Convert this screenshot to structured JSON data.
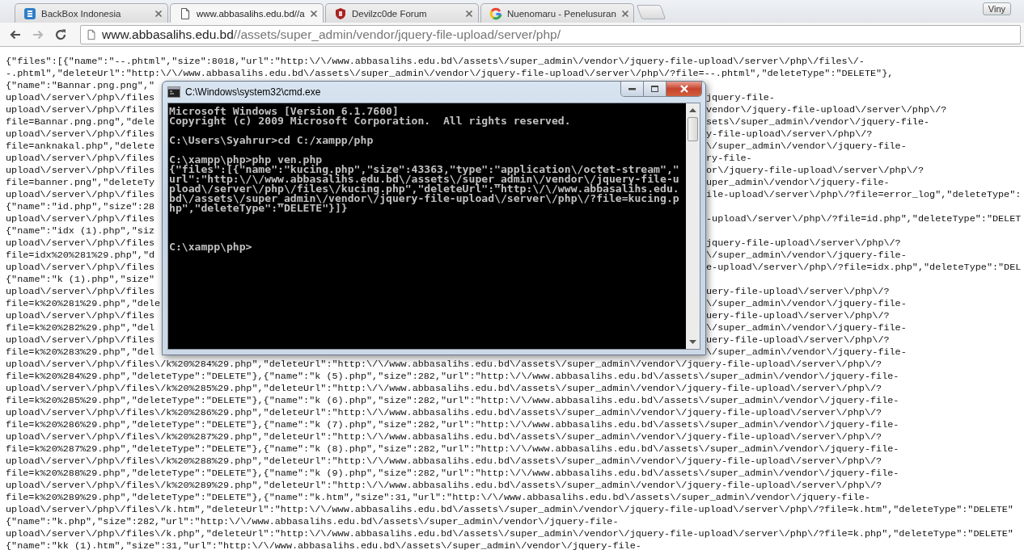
{
  "browser": {
    "tabs": [
      {
        "title": "BackBox Indonesia",
        "kind": "badge",
        "selected": false
      },
      {
        "title": "www.abbasalihs.edu.bd//a",
        "kind": "page",
        "selected": true
      },
      {
        "title": "Devilzc0de Forum",
        "kind": "shield",
        "selected": false
      },
      {
        "title": "Nuenomaru - Penelusuran",
        "kind": "ring",
        "selected": false
      }
    ],
    "profile": "Viny",
    "nav": [
      {
        "kind": "back",
        "disabled": false
      },
      {
        "kind": "forward",
        "disabled": true
      },
      {
        "kind": "reload",
        "disabled": false
      }
    ],
    "address": {
      "host": "www.abbasalihs.edu.bd",
      "path": "//assets/super_admin/vendor/jquery-file-upload/server/php/"
    }
  },
  "page_lines": [
    {
      "kind": "full",
      "text": "{\"files\":[{\"name\":\"--.phtml\",\"size\":8018,\"url\":\"http:\\/\\/www.abbasalihs.edu.bd\\/assets\\/super_admin\\/vendor\\/jquery-file-upload\\/server\\/php\\/files\\/-"
    },
    {
      "kind": "full",
      "text": "-.phtml\",\"deleteUrl\":\"http:\\/\\/www.abbasalihs.edu.bd\\/assets\\/super_admin\\/vendor\\/jquery-file-upload\\/server\\/php\\/?file=--.phtml\",\"deleteType\":\"DELETE\"},"
    },
    {
      "kind": "split",
      "left": "{\"name\":\"Bannar.png.png\",\""
    },
    {
      "kind": "split",
      "left": "upload\\/server\\/php\\/files",
      "right": "jquery-file-"
    },
    {
      "kind": "split",
      "left": "upload\\/server\\/php\\/files",
      "right": "vendor\\/jquery-file-upload\\/server\\/php\\/?"
    },
    {
      "kind": "split",
      "left": "file=Bannar.png.png\",\"dele",
      "right": "sets\\/super_admin\\/vendor\\/jquery-file-"
    },
    {
      "kind": "split",
      "left": "upload\\/server\\/php\\/files",
      "right": "y-file-upload\\/server\\/php\\/?"
    },
    {
      "kind": "split",
      "left": "file=anknakal.php\",\"delete",
      "right": "\\/super_admin\\/vendor\\/jquery-file-"
    },
    {
      "kind": "split",
      "left": "upload\\/server\\/php\\/files",
      "right": "ry-file-"
    },
    {
      "kind": "split",
      "left": "upload\\/server\\/php\\/files",
      "right": "or\\/jquery-file-upload\\/server\\/php\\/?"
    },
    {
      "kind": "split",
      "left": "file=banner.png\",\"deleteTy",
      "right": "uper_admin\\/vendor\\/jquery-file-"
    },
    {
      "kind": "split",
      "left": "upload\\/server\\/php\\/files",
      "right": "ile-upload\\/server\\/php\\/?file=error_log\",\"deleteType\":"
    },
    {
      "kind": "split",
      "left": "{\"name\":\"id.php\",\"size\":28"
    },
    {
      "kind": "split",
      "left": "upload\\/server\\/php\\/files",
      "right": "-upload\\/server\\/php\\/?file=id.php\",\"deleteType\":\"DELET"
    },
    {
      "kind": "split",
      "left": "{\"name\":\"idx (1).php\",\"siz"
    },
    {
      "kind": "split",
      "left": "upload\\/server\\/php\\/files",
      "right": "jquery-file-upload\\/server\\/php\\/?"
    },
    {
      "kind": "split",
      "left": "file=idx%20%281%29.php\",\"d",
      "right": "\\/super_admin\\/vendor\\/jquery-file-"
    },
    {
      "kind": "split",
      "left": "upload\\/server\\/php\\/files",
      "right": "e-upload\\/server\\/php\\/?file=idx.php\",\"deleteType\":\"DEL"
    },
    {
      "kind": "split",
      "left": "{\"name\":\"k (1).php\",\"size\""
    },
    {
      "kind": "split",
      "left": "upload\\/server\\/php\\/files",
      "right": "uery-file-upload\\/server\\/php\\/?"
    },
    {
      "kind": "split",
      "left": "file=k%20%281%29.php\",\"dele",
      "right": "\\/super_admin\\/vendor\\/jquery-file-"
    },
    {
      "kind": "split",
      "left": "upload\\/server\\/php\\/files",
      "right": "uery-file-upload\\/server\\/php\\/?"
    },
    {
      "kind": "split",
      "left": "file=k%20%282%29.php\",\"del",
      "right": "\\/super_admin\\/vendor\\/jquery-file-"
    },
    {
      "kind": "split",
      "left": "upload\\/server\\/php\\/files",
      "right": "uery-file-upload\\/server\\/php\\/?"
    },
    {
      "kind": "split",
      "left": "file=k%20%283%29.php\",\"del",
      "right": "\\/super_admin\\/vendor\\/jquery-file-"
    },
    {
      "kind": "full",
      "text": "upload\\/server\\/php\\/files\\/k%20%284%29.php\",\"deleteUrl\":\"http:\\/\\/www.abbasalihs.edu.bd\\/assets\\/super_admin\\/vendor\\/jquery-file-upload\\/server\\/php\\/?"
    },
    {
      "kind": "full",
      "text": "file=k%20%284%29.php\",\"deleteType\":\"DELETE\"},{\"name\":\"k (5).php\",\"size\":282,\"url\":\"http:\\/\\/www.abbasalihs.edu.bd\\/assets\\/super_admin\\/vendor\\/jquery-file-"
    },
    {
      "kind": "full",
      "text": "upload\\/server\\/php\\/files\\/k%20%285%29.php\",\"deleteUrl\":\"http:\\/\\/www.abbasalihs.edu.bd\\/assets\\/super_admin\\/vendor\\/jquery-file-upload\\/server\\/php\\/?"
    },
    {
      "kind": "full",
      "text": "file=k%20%285%29.php\",\"deleteType\":\"DELETE\"},{\"name\":\"k (6).php\",\"size\":282,\"url\":\"http:\\/\\/www.abbasalihs.edu.bd\\/assets\\/super_admin\\/vendor\\/jquery-file-"
    },
    {
      "kind": "full",
      "text": "upload\\/server\\/php\\/files\\/k%20%286%29.php\",\"deleteUrl\":\"http:\\/\\/www.abbasalihs.edu.bd\\/assets\\/super_admin\\/vendor\\/jquery-file-upload\\/server\\/php\\/?"
    },
    {
      "kind": "full",
      "text": "file=k%20%286%29.php\",\"deleteType\":\"DELETE\"},{\"name\":\"k (7).php\",\"size\":282,\"url\":\"http:\\/\\/www.abbasalihs.edu.bd\\/assets\\/super_admin\\/vendor\\/jquery-file-"
    },
    {
      "kind": "full",
      "text": "upload\\/server\\/php\\/files\\/k%20%287%29.php\",\"deleteUrl\":\"http:\\/\\/www.abbasalihs.edu.bd\\/assets\\/super_admin\\/vendor\\/jquery-file-upload\\/server\\/php\\/?"
    },
    {
      "kind": "full",
      "text": "file=k%20%287%29.php\",\"deleteType\":\"DELETE\"},{\"name\":\"k (8).php\",\"size\":282,\"url\":\"http:\\/\\/www.abbasalihs.edu.bd\\/assets\\/super_admin\\/vendor\\/jquery-file-"
    },
    {
      "kind": "full",
      "text": "upload\\/server\\/php\\/files\\/k%20%288%29.php\",\"deleteUrl\":\"http:\\/\\/www.abbasalihs.edu.bd\\/assets\\/super_admin\\/vendor\\/jquery-file-upload\\/server\\/php\\/?"
    },
    {
      "kind": "full",
      "text": "file=k%20%288%29.php\",\"deleteType\":\"DELETE\"},{\"name\":\"k (9).php\",\"size\":282,\"url\":\"http:\\/\\/www.abbasalihs.edu.bd\\/assets\\/super_admin\\/vendor\\/jquery-file-"
    },
    {
      "kind": "full",
      "text": "upload\\/server\\/php\\/files\\/k%20%289%29.php\",\"deleteUrl\":\"http:\\/\\/www.abbasalihs.edu.bd\\/assets\\/super_admin\\/vendor\\/jquery-file-upload\\/server\\/php\\/?"
    },
    {
      "kind": "full",
      "text": "file=k%20%289%29.php\",\"deleteType\":\"DELETE\"},{\"name\":\"k.htm\",\"size\":31,\"url\":\"http:\\/\\/www.abbasalihs.edu.bd\\/assets\\/super_admin\\/vendor\\/jquery-file-"
    },
    {
      "kind": "full",
      "text": "upload\\/server\\/php\\/files\\/k.htm\",\"deleteUrl\":\"http:\\/\\/www.abbasalihs.edu.bd\\/assets\\/super_admin\\/vendor\\/jquery-file-upload\\/server\\/php\\/?file=k.htm\",\"deleteType\":\"DELETE\""
    },
    {
      "kind": "full",
      "text": "{\"name\":\"k.php\",\"size\":282,\"url\":\"http:\\/\\/www.abbasalihs.edu.bd\\/assets\\/super_admin\\/vendor\\/jquery-file-"
    },
    {
      "kind": "full",
      "text": "upload\\/server\\/php\\/files\\/k.php\",\"deleteUrl\":\"http:\\/\\/www.abbasalihs.edu.bd\\/assets\\/super_admin\\/vendor\\/jquery-file-upload\\/server\\/php\\/?file=k.php\",\"deleteType\":\"DELETE\""
    },
    {
      "kind": "full",
      "text": "{\"name\":\"kk (1).htm\",\"size\":31,\"url\":\"http:\\/\\/www.abbasalihs.edu.bd\\/assets\\/super_admin\\/vendor\\/jquery-file-"
    }
  ],
  "console_window": {
    "title": "C:\\Windows\\system32\\cmd.exe",
    "text": "Microsoft Windows [Version 6.1.7600]\nCopyright (c) 2009 Microsoft Corporation.  All rights reserved.\n\nC:\\Users\\Syahrur>cd C:/xampp/php\n\nC:\\xampp\\php>php ven.php\n{\"files\":[{\"name\":\"kucing.php\",\"size\":43363,\"type\":\"application\\/octet-stream\",\"\nurl\":\"http:\\/\\/www.abbasalihs.edu.bd\\/assets\\/super_admin\\/vendor\\/jquery-file-u\npload\\/server\\/php\\/files\\/kucing.php\",\"deleteUrl\":\"http:\\/\\/www.abbasalihs.edu.\nbd\\/assets\\/super_admin\\/vendor\\/jquery-file-upload\\/server\\/php\\/?file=kucing.p\nhp\",\"deleteType\":\"DELETE\"}]}\n\n\n\nC:\\xampp\\php>"
  }
}
